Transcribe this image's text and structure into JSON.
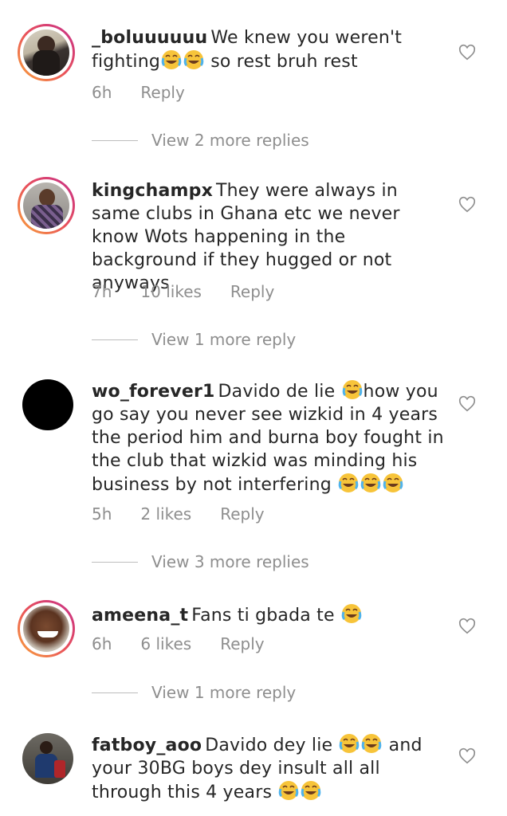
{
  "comments": [
    {
      "username": "_boluuuuuu",
      "text_parts": [
        "We knew you weren't fighting",
        "😂😂",
        " so rest bruh rest"
      ],
      "time": "6h",
      "likes": "",
      "reply": "Reply",
      "view_more": "View 2 more replies",
      "avatar_ring": true
    },
    {
      "username": "kingchampx",
      "text_parts": [
        "They were always in same clubs in Ghana etc we never know Wots happening in the background if they hugged or not anyways"
      ],
      "time": "7h",
      "likes": "10 likes",
      "reply": "Reply",
      "view_more": "View 1 more reply",
      "avatar_ring": true
    },
    {
      "username": "wo_forever1",
      "text_parts": [
        "Davido de lie ",
        "😂",
        "how you go say you never see wizkid in 4 years the period him and burna boy fought in the club that wizkid was minding his business by not interfering ",
        "😂😂😂"
      ],
      "time": "5h",
      "likes": "2 likes",
      "reply": "Reply",
      "view_more": "View 3 more replies",
      "avatar_ring": false
    },
    {
      "username": "ameena_t",
      "text_parts": [
        "Fans ti gbada te ",
        "😂"
      ],
      "time": "6h",
      "likes": "6 likes",
      "reply": "Reply",
      "view_more": "View 1 more reply",
      "avatar_ring": true
    },
    {
      "username": "fatboy_aoo",
      "text_parts": [
        "Davido dey lie ",
        "😂😂",
        " and your 30BG boys dey insult all all through this 4 years ",
        "😂😂"
      ],
      "time": "",
      "likes": "",
      "reply": "",
      "view_more": "",
      "avatar_ring": false
    }
  ],
  "icons": {
    "like": "heart-outline-icon",
    "laugh": "face-with-tears-of-joy-emoji"
  },
  "colors": {
    "text": "#262626",
    "meta": "#8e8e8e",
    "ring_start": "#f9a43a",
    "ring_end": "#c62f8a",
    "emoji": "#f7c43a"
  }
}
